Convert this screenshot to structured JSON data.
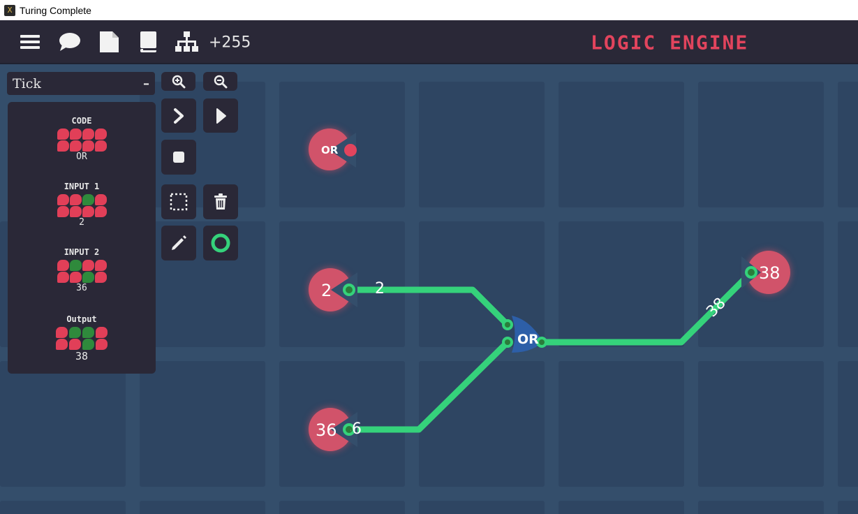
{
  "window": {
    "title": "Turing Complete"
  },
  "toolbar": {
    "icons": [
      "menu-icon",
      "chat-icon",
      "document-icon",
      "book-icon",
      "hierarchy-icon"
    ],
    "counter": "+255",
    "level_name": "LOGIC ENGINE"
  },
  "sidebar": {
    "tick_select": {
      "value": "Tick",
      "collapse_label": "–"
    },
    "sections": [
      {
        "label": "CODE",
        "bits": [
          0,
          0,
          0,
          0,
          0,
          0,
          0,
          0
        ],
        "value": "OR"
      },
      {
        "label": "INPUT 1",
        "bits": [
          0,
          0,
          1,
          0,
          0,
          0,
          0,
          0
        ],
        "value": "2"
      },
      {
        "label": "INPUT 2",
        "bits": [
          0,
          1,
          0,
          0,
          0,
          0,
          1,
          0
        ],
        "value": "36"
      },
      {
        "label": "Output",
        "bits": [
          0,
          1,
          1,
          0,
          0,
          0,
          1,
          0
        ],
        "value": "38"
      }
    ]
  },
  "tools": [
    "zoom-in-icon",
    "zoom-out-icon",
    "step-icon",
    "play-icon",
    "stop-icon",
    "select-icon",
    "delete-icon",
    "pencil-icon",
    "ring-icon"
  ],
  "board": {
    "code_input": {
      "label": "OR"
    },
    "input1": {
      "value": "2",
      "wire_label": "2"
    },
    "input2": {
      "value": "36",
      "wire_label": "36"
    },
    "gate": {
      "label": "OR"
    },
    "output": {
      "value": "38",
      "wire_label": "38"
    }
  },
  "colors": {
    "wire": "#35d27b",
    "node": "#d1536a",
    "gate": "#2d5fa8",
    "accent": "#e2445d"
  }
}
